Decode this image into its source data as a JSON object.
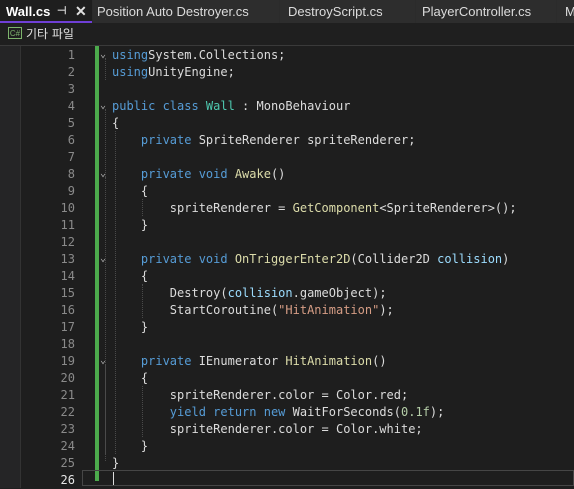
{
  "tabs": [
    {
      "label": "Wall.cs",
      "active": true
    },
    {
      "label": "Position Auto Destroyer.cs"
    },
    {
      "label": "DestroyScript.cs"
    },
    {
      "label": "PlayerController.cs"
    },
    {
      "label": "M"
    }
  ],
  "tab_pin_glyph": "⊣",
  "tab_close_glyph": "✕",
  "nav": {
    "icon_text": "C#",
    "label": "기타 파일"
  },
  "editor": {
    "current_line": 26,
    "line_numbers": [
      "1",
      "2",
      "3",
      "4",
      "5",
      "6",
      "7",
      "8",
      "9",
      "10",
      "11",
      "12",
      "13",
      "14",
      "15",
      "16",
      "17",
      "18",
      "19",
      "20",
      "21",
      "22",
      "23",
      "24",
      "25",
      "26"
    ],
    "lines": [
      [
        [
          "k",
          "using"
        ],
        [
          "",
          "System.Collections;"
        ]
      ],
      [
        [
          "k",
          "using"
        ],
        [
          "",
          "UnityEngine;"
        ]
      ],
      [],
      [
        [
          "k",
          "public class "
        ],
        [
          "t",
          "Wall"
        ],
        [
          "",
          " : MonoBehaviour"
        ]
      ],
      [
        [
          "",
          "{"
        ]
      ],
      [
        [
          "",
          "    "
        ],
        [
          "k",
          "private "
        ],
        [
          "",
          "SpriteRenderer spriteRenderer;"
        ]
      ],
      [],
      [
        [
          "",
          "    "
        ],
        [
          "k",
          "private void "
        ],
        [
          "f",
          "Awake"
        ],
        [
          "",
          "()"
        ]
      ],
      [
        [
          "",
          "    {"
        ]
      ],
      [
        [
          "",
          "        spriteRenderer = "
        ],
        [
          "f",
          "GetComponent"
        ],
        [
          "",
          "<SpriteRenderer>();"
        ]
      ],
      [
        [
          "",
          "    }"
        ]
      ],
      [],
      [
        [
          "",
          "    "
        ],
        [
          "k",
          "private void "
        ],
        [
          "f",
          "OnTriggerEnter2D"
        ],
        [
          "",
          "(Collider2D "
        ],
        [
          "p",
          "collision"
        ],
        [
          "",
          ")"
        ]
      ],
      [
        [
          "",
          "    {"
        ]
      ],
      [
        [
          "",
          "        Destroy("
        ],
        [
          "p",
          "collision"
        ],
        [
          "",
          ".gameObject);"
        ]
      ],
      [
        [
          "",
          "        StartCoroutine("
        ],
        [
          "s",
          "\"HitAnimation\""
        ],
        [
          "",
          ");"
        ]
      ],
      [
        [
          "",
          "    }"
        ]
      ],
      [],
      [
        [
          "",
          "    "
        ],
        [
          "k",
          "private "
        ],
        [
          "",
          "IEnumerator "
        ],
        [
          "f",
          "HitAnimation"
        ],
        [
          "",
          "()"
        ]
      ],
      [
        [
          "",
          "    {"
        ]
      ],
      [
        [
          "",
          "        spriteRenderer.color = Color.red;"
        ]
      ],
      [
        [
          "",
          "        "
        ],
        [
          "k",
          "yield return new "
        ],
        [
          "",
          "WaitForSeconds("
        ],
        [
          "n",
          "0.1f"
        ],
        [
          "",
          ");"
        ]
      ],
      [
        [
          "",
          "        spriteRenderer.color = Color.white;"
        ]
      ],
      [
        [
          "",
          "    }"
        ]
      ],
      [
        [
          "",
          "}"
        ]
      ],
      []
    ]
  }
}
